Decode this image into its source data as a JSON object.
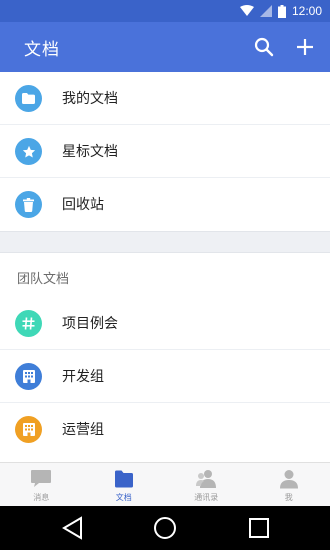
{
  "status_bar": {
    "time": "12:00"
  },
  "app_bar": {
    "title": "文档"
  },
  "my_items": [
    {
      "label": "我的文档",
      "icon": "folder-icon",
      "color": "#4ba6e6"
    },
    {
      "label": "星标文档",
      "icon": "star-icon",
      "color": "#4ba6e6"
    },
    {
      "label": "回收站",
      "icon": "trash-icon",
      "color": "#4ba6e6"
    }
  ],
  "team_section": {
    "title": "团队文档",
    "items": [
      {
        "label": "项目例会",
        "icon": "hash-icon",
        "color": "#3fd8b7"
      },
      {
        "label": "开发组",
        "icon": "building-icon",
        "color": "#3f7ed8"
      },
      {
        "label": "运营组",
        "icon": "building-icon",
        "color": "#f0a023"
      }
    ]
  },
  "tabs": [
    {
      "label": "消息",
      "icon": "chat-icon",
      "active": false
    },
    {
      "label": "文档",
      "icon": "folder-icon",
      "active": true
    },
    {
      "label": "通讯录",
      "icon": "contacts-icon",
      "active": false
    },
    {
      "label": "我",
      "icon": "person-icon",
      "active": false
    }
  ],
  "colors": {
    "status_bar": "#3a63c9",
    "app_bar": "#4a72da",
    "accent": "#3a63c9",
    "inactive_tab": "#9a9a9a"
  }
}
